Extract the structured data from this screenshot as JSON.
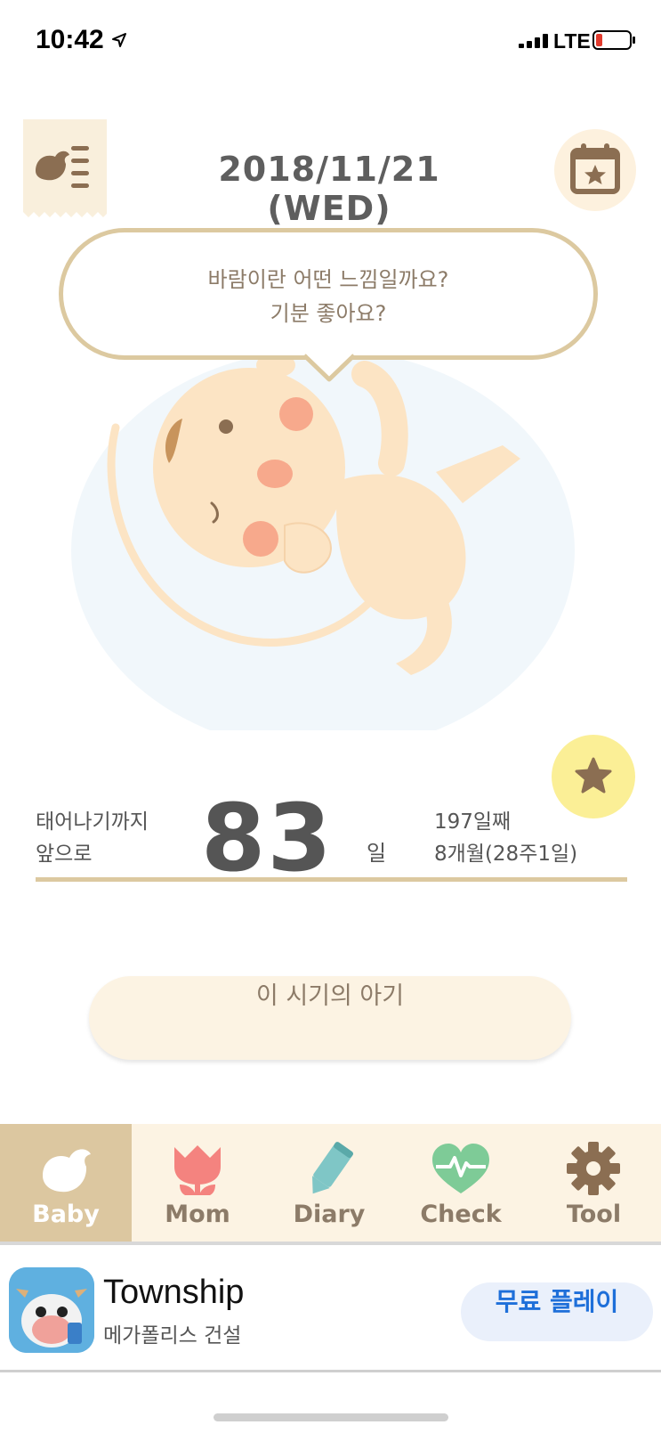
{
  "status_bar": {
    "time": "10:42",
    "network": "LTE"
  },
  "header": {
    "date": "2018/11/21 (WED)",
    "menu_icon": "bird-menu-icon",
    "calendar_icon": "calendar-star-icon"
  },
  "bubble": {
    "line1": "바람이란 어떤 느낌일까요?",
    "line2": "기분 좋아요?"
  },
  "countdown": {
    "label_line1": "태어나기까지",
    "label_line2": "앞으로",
    "days": "83",
    "unit": "일",
    "info_line1": "197일째",
    "info_line2": "8개월(28주1일)"
  },
  "period_button": {
    "label": "이 시기의 아기"
  },
  "tabs": [
    {
      "label": "Baby",
      "icon": "bird-icon",
      "active": true
    },
    {
      "label": "Mom",
      "icon": "tulip-icon",
      "active": false
    },
    {
      "label": "Diary",
      "icon": "pencil-icon",
      "active": false
    },
    {
      "label": "Check",
      "icon": "heartbeat-icon",
      "active": false
    },
    {
      "label": "Tool",
      "icon": "gear-icon",
      "active": false
    }
  ],
  "ad": {
    "title": "Township",
    "subtitle": "메가폴리스 건설",
    "cta": "무료 플레이"
  },
  "colors": {
    "accent_beige": "#dcc9a0",
    "tab_bg": "#fcf3e3",
    "active_tab": "#dcc7a0",
    "text_brown": "#8c7b68",
    "star_yellow": "#fbef96",
    "cta_blue": "#1e6fd9"
  }
}
